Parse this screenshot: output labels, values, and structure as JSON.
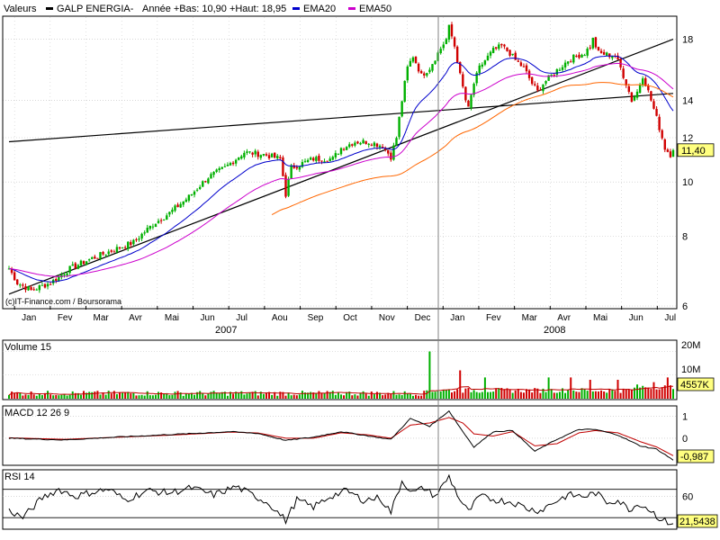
{
  "header": {
    "valeurs_label": "Valeurs",
    "series_name": "GALP ENERGIA-",
    "range_text": "Année +Bas: 10,90 +Haut: 18,95",
    "ema20_label": "EMA20",
    "ema50_label": "EMA50"
  },
  "watermark": "(c)IT-Finance.com / Boursorama",
  "colors": {
    "background": "#ffffff",
    "panel_border": "#000000",
    "grid": "#c0c0c0",
    "candle_up": "#00b000",
    "candle_down": "#d00000",
    "ema20": "#0000cc",
    "ema50": "#cc00cc",
    "mm200": "#ff6600",
    "trendline": "#000000",
    "last_label_bg": "#ffff80",
    "volume_avg": "#c00000",
    "macd_line": "#000000",
    "signal_line": "#c00000",
    "rsi_line": "#000000"
  },
  "chart_data": [
    {
      "type": "candlestick",
      "name": "GALP ENERGIA-",
      "x_months": [
        "Jan",
        "Fev",
        "Mar",
        "Avr",
        "Mai",
        "Jun",
        "Jul",
        "Aou",
        "Sep",
        "Oct",
        "Nov",
        "Dec",
        "Jan",
        "Fev",
        "Mar",
        "Avr",
        "Mai",
        "Jun",
        "Jul"
      ],
      "x_years": [
        "2007",
        "2008"
      ],
      "y_ticks": [
        6,
        8,
        10,
        12,
        14,
        18
      ],
      "ylim": [
        6,
        19.5
      ],
      "y_scale": "log",
      "last_value": "11,40",
      "period_low": 10.9,
      "period_high": 18.95,
      "price_anchors": [
        [
          0,
          7.0
        ],
        [
          3,
          6.6
        ],
        [
          8,
          6.4
        ],
        [
          15,
          6.6
        ],
        [
          22,
          7.0
        ],
        [
          30,
          7.3
        ],
        [
          36,
          7.5
        ],
        [
          45,
          7.8
        ],
        [
          52,
          8.4
        ],
        [
          58,
          8.8
        ],
        [
          65,
          9.4
        ],
        [
          72,
          10.2
        ],
        [
          78,
          10.6
        ],
        [
          85,
          11.3
        ],
        [
          92,
          11.2
        ],
        [
          98,
          11.0
        ],
        [
          100,
          9.5
        ],
        [
          102,
          10.6
        ],
        [
          110,
          11.0
        ],
        [
          117,
          11.0
        ],
        [
          120,
          11.5
        ],
        [
          125,
          11.8
        ],
        [
          130,
          11.8
        ],
        [
          135,
          11.6
        ],
        [
          138,
          11.1
        ],
        [
          140,
          12.0
        ],
        [
          142,
          14.0
        ],
        [
          144,
          16.0
        ],
        [
          146,
          16.8
        ],
        [
          149,
          15.5
        ],
        [
          152,
          16.0
        ],
        [
          155,
          17.0
        ],
        [
          158,
          18.0
        ],
        [
          159,
          18.9
        ],
        [
          161,
          17.5
        ],
        [
          163,
          15.5
        ],
        [
          165,
          14.0
        ],
        [
          166,
          13.5
        ],
        [
          168,
          15.0
        ],
        [
          170,
          16.0
        ],
        [
          172,
          16.5
        ],
        [
          175,
          17.2
        ],
        [
          178,
          17.5
        ],
        [
          181,
          17.0
        ],
        [
          183,
          16.5
        ],
        [
          186,
          16.0
        ],
        [
          189,
          15.0
        ],
        [
          191,
          14.5
        ],
        [
          193,
          15.0
        ],
        [
          196,
          15.5
        ],
        [
          199,
          16.0
        ],
        [
          202,
          16.5
        ],
        [
          205,
          16.8
        ],
        [
          208,
          17.0
        ],
        [
          210,
          17.5
        ],
        [
          211,
          18.0
        ],
        [
          213,
          17.0
        ],
        [
          216,
          16.9
        ],
        [
          219,
          16.8
        ],
        [
          221,
          16.0
        ],
        [
          223,
          15.0
        ],
        [
          225,
          14.0
        ],
        [
          227,
          14.5
        ],
        [
          229,
          15.5
        ],
        [
          231,
          14.5
        ],
        [
          233,
          13.5
        ],
        [
          235,
          12.5
        ],
        [
          237,
          11.5
        ],
        [
          239,
          11.2
        ],
        [
          240,
          11.4
        ]
      ],
      "trendlines": [
        {
          "from": [
            0,
            6.3
          ],
          "to": [
            240,
            18.0
          ]
        },
        {
          "from": [
            0,
            11.8
          ],
          "to": [
            240,
            14.4
          ]
        }
      ],
      "mm200_start_index": 95,
      "series": [
        {
          "name": "EMA20",
          "period": 20,
          "color_key": "ema20"
        },
        {
          "name": "EMA50",
          "period": 50,
          "color_key": "ema50"
        },
        {
          "name": "",
          "period": 200,
          "color_key": "mm200"
        }
      ]
    },
    {
      "type": "bar",
      "name": "Volume 15",
      "y_ticks_labels": [
        "20M",
        "10M"
      ],
      "y_ticks": [
        20,
        10
      ],
      "ylim": [
        0,
        24
      ],
      "last_value": "4557K",
      "spikes": [
        [
          152,
          20
        ],
        [
          163,
          12
        ],
        [
          172,
          9
        ],
        [
          195,
          9
        ],
        [
          203,
          9
        ],
        [
          210,
          8
        ],
        [
          220,
          8
        ],
        [
          233,
          7
        ],
        [
          238,
          9
        ]
      ]
    },
    {
      "type": "line",
      "name": "MACD 12 26 9",
      "y_ticks": [
        1,
        0
      ],
      "ylim": [
        -1.2,
        1.4
      ],
      "last_value": "-0,987",
      "values_anchors": [
        [
          0,
          0.0
        ],
        [
          20,
          -0.08
        ],
        [
          40,
          0.06
        ],
        [
          60,
          0.18
        ],
        [
          80,
          0.3
        ],
        [
          90,
          0.22
        ],
        [
          100,
          -0.1
        ],
        [
          110,
          0.05
        ],
        [
          120,
          0.3
        ],
        [
          130,
          0.1
        ],
        [
          138,
          -0.05
        ],
        [
          145,
          0.9
        ],
        [
          152,
          0.55
        ],
        [
          159,
          1.25
        ],
        [
          164,
          0.3
        ],
        [
          168,
          -0.4
        ],
        [
          175,
          0.3
        ],
        [
          182,
          0.35
        ],
        [
          190,
          -0.6
        ],
        [
          198,
          -0.05
        ],
        [
          206,
          0.4
        ],
        [
          212,
          0.4
        ],
        [
          220,
          0.15
        ],
        [
          228,
          -0.35
        ],
        [
          234,
          -0.5
        ],
        [
          240,
          -1.0
        ]
      ],
      "signal_anchors": [
        [
          0,
          0.02
        ],
        [
          20,
          -0.05
        ],
        [
          40,
          0.05
        ],
        [
          60,
          0.15
        ],
        [
          80,
          0.28
        ],
        [
          90,
          0.24
        ],
        [
          100,
          0.0
        ],
        [
          110,
          0.0
        ],
        [
          120,
          0.25
        ],
        [
          130,
          0.15
        ],
        [
          138,
          0.0
        ],
        [
          145,
          0.6
        ],
        [
          152,
          0.7
        ],
        [
          159,
          0.95
        ],
        [
          164,
          0.7
        ],
        [
          168,
          0.2
        ],
        [
          175,
          0.1
        ],
        [
          182,
          0.3
        ],
        [
          190,
          -0.35
        ],
        [
          198,
          -0.25
        ],
        [
          206,
          0.25
        ],
        [
          212,
          0.35
        ],
        [
          220,
          0.25
        ],
        [
          228,
          -0.15
        ],
        [
          234,
          -0.4
        ],
        [
          240,
          -0.8
        ]
      ]
    },
    {
      "type": "line",
      "name": "RSI 14",
      "y_ticks": [
        60
      ],
      "ylim": [
        15,
        95
      ],
      "levels": [
        70,
        30
      ],
      "last_value": "21,5438",
      "values_anchors": [
        [
          0,
          40
        ],
        [
          5,
          30
        ],
        [
          12,
          58
        ],
        [
          18,
          70
        ],
        [
          24,
          60
        ],
        [
          30,
          66
        ],
        [
          36,
          70
        ],
        [
          42,
          55
        ],
        [
          50,
          68
        ],
        [
          58,
          65
        ],
        [
          66,
          72
        ],
        [
          74,
          62
        ],
        [
          82,
          74
        ],
        [
          88,
          62
        ],
        [
          94,
          50
        ],
        [
          100,
          26
        ],
        [
          104,
          55
        ],
        [
          110,
          45
        ],
        [
          116,
          60
        ],
        [
          122,
          68
        ],
        [
          128,
          55
        ],
        [
          134,
          58
        ],
        [
          138,
          38
        ],
        [
          142,
          82
        ],
        [
          146,
          65
        ],
        [
          150,
          72
        ],
        [
          154,
          60
        ],
        [
          159,
          88
        ],
        [
          163,
          55
        ],
        [
          166,
          38
        ],
        [
          170,
          60
        ],
        [
          176,
          55
        ],
        [
          182,
          52
        ],
        [
          188,
          42
        ],
        [
          192,
          40
        ],
        [
          196,
          50
        ],
        [
          202,
          62
        ],
        [
          208,
          60
        ],
        [
          212,
          65
        ],
        [
          216,
          52
        ],
        [
          220,
          55
        ],
        [
          224,
          42
        ],
        [
          228,
          50
        ],
        [
          232,
          40
        ],
        [
          236,
          26
        ],
        [
          240,
          21.5
        ]
      ]
    }
  ]
}
